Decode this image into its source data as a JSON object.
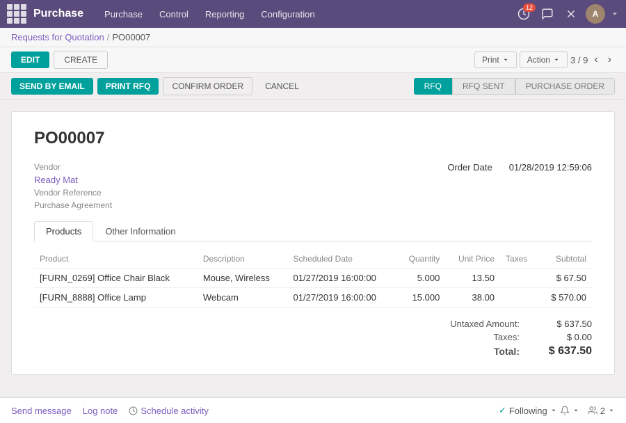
{
  "app": {
    "title": "Purchase",
    "grid_icon": "apps-icon"
  },
  "nav": {
    "menu_items": [
      "Purchase",
      "Control",
      "Reporting",
      "Configuration"
    ],
    "badge_count": "12",
    "avatar_initials": "A"
  },
  "breadcrumb": {
    "parent": "Requests for Quotation",
    "separator": "/",
    "current": "PO00007"
  },
  "action_bar": {
    "edit_label": "EDIT",
    "create_label": "CREATE",
    "print_label": "Print",
    "action_label": "Action",
    "pagination": "3 / 9"
  },
  "toolbar": {
    "send_email_label": "SEND BY EMAIL",
    "print_rfq_label": "PRINT RFQ",
    "confirm_order_label": "CONFIRM ORDER",
    "cancel_label": "CANCEL",
    "status_rfq": "RFQ",
    "status_rfq_sent": "RFQ SENT",
    "status_purchase_order": "PURCHASE ORDER"
  },
  "document": {
    "po_number": "PO00007",
    "vendor_label": "Vendor",
    "vendor_value": "Ready Mat",
    "vendor_ref_label": "Vendor Reference",
    "purchase_agreement_label": "Purchase Agreement",
    "order_date_label": "Order Date",
    "order_date_value": "01/28/2019 12:59:06"
  },
  "tabs": [
    {
      "id": "products",
      "label": "Products",
      "active": true
    },
    {
      "id": "other",
      "label": "Other Information",
      "active": false
    }
  ],
  "table": {
    "headers": [
      "Product",
      "Description",
      "Scheduled Date",
      "Quantity",
      "Unit Price",
      "Taxes",
      "Subtotal"
    ],
    "rows": [
      {
        "product": "[FURN_0269] Office Chair Black",
        "description": "Mouse, Wireless",
        "scheduled_date": "01/27/2019 16:00:00",
        "quantity": "5.000",
        "unit_price": "13.50",
        "taxes": "",
        "subtotal": "$ 67.50"
      },
      {
        "product": "[FURN_8888] Office Lamp",
        "description": "Webcam",
        "scheduled_date": "01/27/2019 16:00:00",
        "quantity": "15.000",
        "unit_price": "38.00",
        "taxes": "",
        "subtotal": "$ 570.00"
      }
    ]
  },
  "totals": {
    "untaxed_label": "Untaxed Amount:",
    "untaxed_value": "$ 637.50",
    "taxes_label": "Taxes:",
    "taxes_value": "$ 0.00",
    "total_label": "Total:",
    "total_value": "$ 637.50"
  },
  "bottom": {
    "send_message_label": "Send message",
    "log_note_label": "Log note",
    "schedule_activity_label": "Schedule activity",
    "following_label": "Following",
    "followers_count": "2"
  }
}
